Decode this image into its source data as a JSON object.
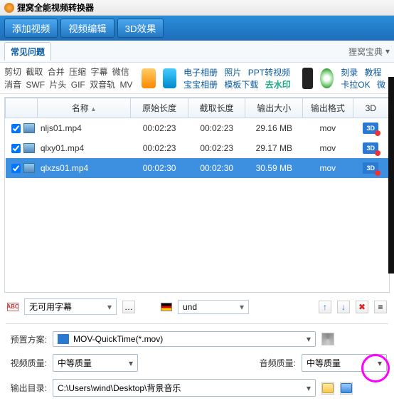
{
  "title": "狸窝全能视频转换器",
  "toolbar": {
    "add": "添加视频",
    "edit": "视频编辑",
    "fx": "3D效果"
  },
  "subbar": {
    "tab": "常见问题",
    "right": "狸窝宝典"
  },
  "ad": {
    "tags1": [
      "剪切",
      "截取",
      "合并",
      "压缩",
      "字幕",
      "微信"
    ],
    "tags2": [
      "消音",
      "SWF",
      "片头",
      "GIF",
      "双音轨",
      "MV"
    ],
    "links1": [
      "电子相册",
      "照片",
      "PPT转视频"
    ],
    "links2a": [
      "宝宝相册",
      "模板下载"
    ],
    "links2_hl": "去水印",
    "rcol": [
      "刻录",
      "教程",
      "卡拉OK",
      "微"
    ]
  },
  "columns": {
    "name": "名称",
    "orig": "原始长度",
    "cut": "截取长度",
    "size": "输出大小",
    "fmt": "输出格式",
    "d3": "3D"
  },
  "rows": [
    {
      "name": "nljs01.mp4",
      "orig": "00:02:23",
      "cut": "00:02:23",
      "size": "29.16 MB",
      "fmt": "mov",
      "sel": false
    },
    {
      "name": "qlxy01.mp4",
      "orig": "00:02:23",
      "cut": "00:02:23",
      "size": "29.17 MB",
      "fmt": "mov",
      "sel": false
    },
    {
      "name": "qlxzs01.mp4",
      "orig": "00:02:30",
      "cut": "00:02:30",
      "size": "30.59 MB",
      "fmt": "mov",
      "sel": true
    }
  ],
  "mid": {
    "sub": "无可用字幕",
    "lang": "und"
  },
  "bottom": {
    "preset_lbl": "预置方案:",
    "preset": "MOV-QuickTime(*.mov)",
    "vq_lbl": "视频质量:",
    "vq": "中等质量",
    "aq_lbl": "音频质量:",
    "aq": "中等质量",
    "out_lbl": "输出目录:",
    "out": "C:\\Users\\wind\\Desktop\\背景音乐"
  },
  "d3_label": "3D"
}
